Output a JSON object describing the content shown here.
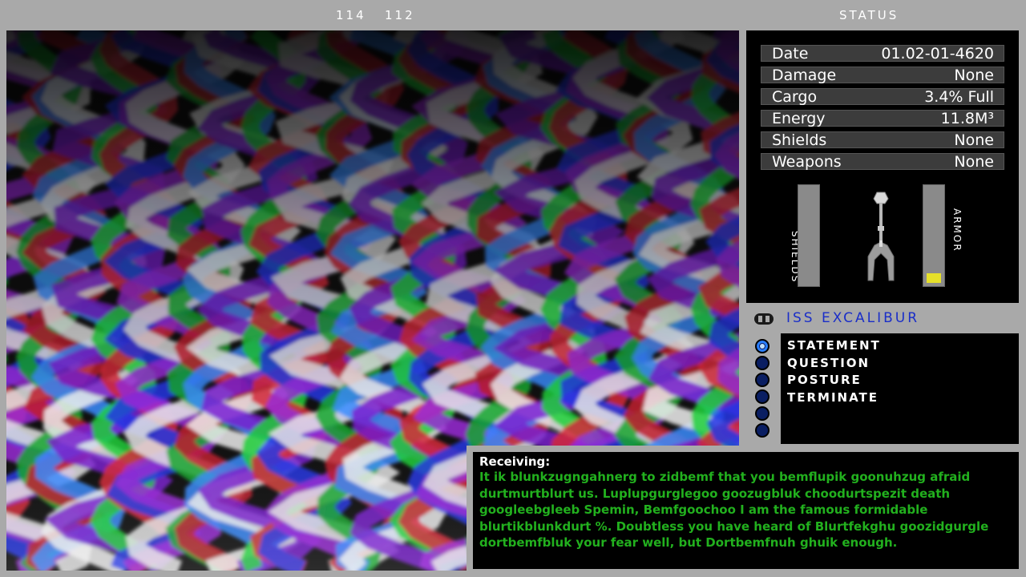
{
  "header": {
    "coord_a": "114",
    "coord_b": "112",
    "status_title": "STATUS"
  },
  "status": {
    "rows": [
      {
        "label": "Date",
        "value": "01.02-01-4620"
      },
      {
        "label": "Damage",
        "value": "None"
      },
      {
        "label": "Cargo",
        "value": "3.4% Full"
      },
      {
        "label": "Energy",
        "value": "11.8M³"
      },
      {
        "label": "Shields",
        "value": "None"
      },
      {
        "label": "Weapons",
        "value": "None"
      }
    ],
    "shields_label": "SHIELDS",
    "armor_label": "ARMOR",
    "shields_level": 0,
    "armor_level": 0.1,
    "armor_color": "#e6e02a"
  },
  "ship": {
    "name": "ISS EXCALIBUR",
    "name_color": "#1a2ec8"
  },
  "responses": {
    "options": [
      "STATEMENT",
      "QUESTION",
      "POSTURE",
      "TERMINATE"
    ],
    "selected_index": 0
  },
  "message": {
    "heading": "Receiving:",
    "body": "It ik blunkzugngahnerg to zidbemf that you bemflupik goonuhzug afraid durtmurtblurt us. Luplupgurglegoo goozugbluk choodurtspezit death googleebgleeb Spemin, Bemfgoochoo I am the famous formidable blurtikblunkdurt %. Doubtless you have heard of Blurtfekghu goozidgurgle dortbemfbluk your fear well, but Dortbemfnuh ghuik enough.",
    "body_color": "#22b01e"
  }
}
